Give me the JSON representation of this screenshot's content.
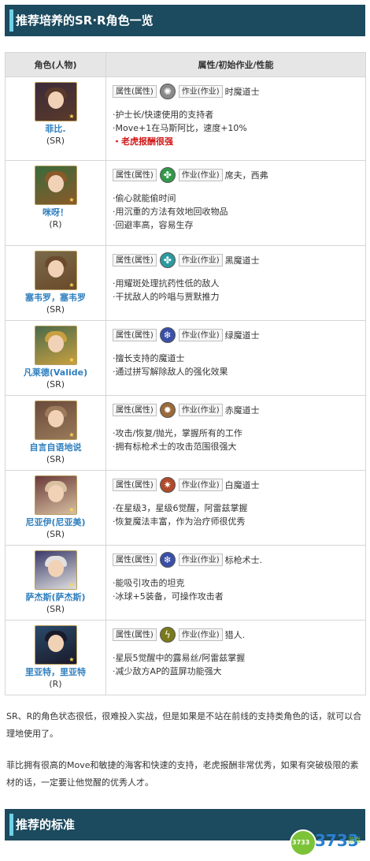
{
  "section1": {
    "title": "推荐培养的SR·R角色一览"
  },
  "table": {
    "col1": "角色(人物)",
    "col2": "属性/初始作业/性能"
  },
  "rows": [
    {
      "name": "菲比.",
      "rarity": "(SR)",
      "attr": "属性(属性)",
      "jobtag": "作业(作业)",
      "job": "时魔道士",
      "icon": "time-icon",
      "iconColor": "#8a8a8a",
      "desc": [
        "·护士长/快速使用的支持者",
        "·Move+1在马斯阿比，速度+10%"
      ],
      "red": "・老虎报酬很强"
    },
    {
      "name": "咪呀！",
      "rarity": "(R)",
      "attr": "属性(属性)",
      "jobtag": "作业(作业)",
      "job": "席夫，西弗",
      "icon": "wind-icon",
      "iconColor": "#2f9a4a",
      "desc": [
        "·偷心就能偷时间",
        "·用沉重的方法有效地回收物品",
        "·回避率高，容易生存"
      ]
    },
    {
      "name": "塞韦罗，塞韦罗",
      "rarity": "(SR)",
      "attr": "属性(属性)",
      "jobtag": "作业(作业)",
      "job": "黑魔道士",
      "icon": "wind-icon",
      "iconColor": "#2a9aa0",
      "desc": [
        "·用耀斑处理抗药性低的敌人",
        "·干扰敌人的吟唱与贾默推力"
      ]
    },
    {
      "name": "凡莱德(Valide)",
      "rarity": "(SR)",
      "attr": "属性(属性)",
      "jobtag": "作业(作业)",
      "job": "绿魔道士",
      "icon": "ice-icon",
      "iconColor": "#3a4fa8",
      "desc": [
        "·擅长支持的魔道士",
        "·通过拼写解除敌人的强化效果"
      ]
    },
    {
      "name": "自言自语地说",
      "rarity": "(SR)",
      "attr": "属性(属性)",
      "jobtag": "作业(作业)",
      "job": "赤魔道士",
      "icon": "earth-icon",
      "iconColor": "#9a6a3a",
      "desc": [
        "·攻击/恢复/抛光，掌握所有的工作",
        "·拥有标枪术士的攻击范围很强大"
      ]
    },
    {
      "name": "尼亚伊(尼亚美)",
      "rarity": "(SR)",
      "attr": "属性(属性)",
      "jobtag": "作业(作业)",
      "job": "白魔道士",
      "icon": "fire-icon",
      "iconColor": "#b04a2a",
      "desc": [
        "·在星级3，星级6觉醒，阿雷兹掌握",
        "·恢复魔法丰富，作为治疗师很优秀"
      ]
    },
    {
      "name": "萨杰斯(萨杰斯)",
      "rarity": "(SR)",
      "attr": "属性(属性)",
      "jobtag": "作业(作业)",
      "job": "标枪术士.",
      "icon": "ice-icon",
      "iconColor": "#3a4fa8",
      "desc": [
        "·能吸引攻击的坦克",
        "·冰球+5装备，可操作攻击者"
      ]
    },
    {
      "name": "里亚特，里亚特",
      "rarity": "(R)",
      "attr": "属性(属性)",
      "jobtag": "作业(作业)",
      "job": "猎人.",
      "icon": "thunder-icon",
      "iconColor": "#7a7a1a",
      "desc": [
        "·星辰5觉醒中的露易丝/阿雷兹掌握",
        "·减少敌方AP的蓝屏功能强大"
      ]
    }
  ],
  "paragraphs": {
    "p1": "SR、R的角色状态很低，很难投入实战，但是如果是不站在前线的支持类角色的话，就可以合理地使用了。",
    "p2": "菲比拥有很高的Move和敏捷的海客和快速的支持，老虎报酬非常优秀，如果有突破极限的素材的话，一定要让他觉醒的优秀人才。"
  },
  "section2": {
    "title": "推荐的标准"
  },
  "logo": {
    "num1": "3733",
    "num2": "3733",
    "sub": "游戏"
  }
}
